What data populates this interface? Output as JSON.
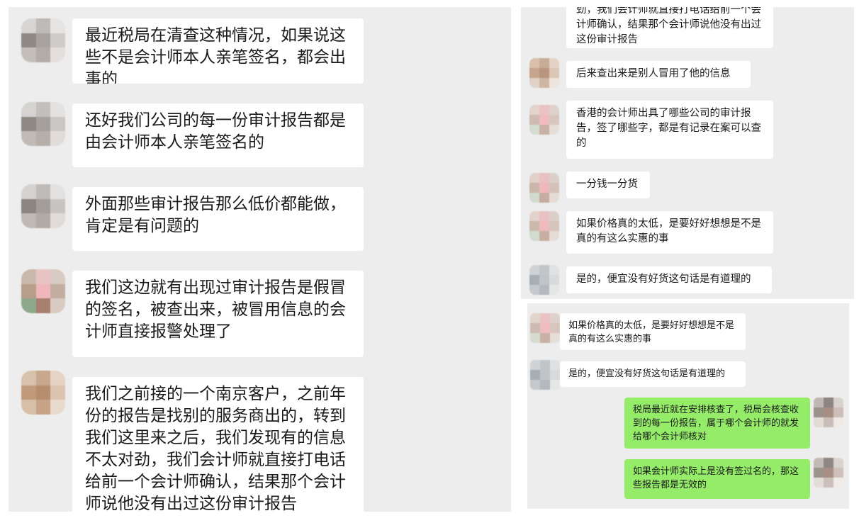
{
  "left_chat": {
    "messages": [
      {
        "text": "最近税局在清查这种情况，如果说这些不是会计师本人亲笔签名，都会出事的"
      },
      {
        "text": "还好我们公司的每一份审计报告都是由会计师本人亲笔签名的"
      },
      {
        "text": "外面那些审计报告那么低价都能做，肯定是有问题的"
      },
      {
        "text": "我们这边就有出现过审计报告是假冒的签名，被查出来，被冒用信息的会计师直接报警处理了"
      },
      {
        "text": "我们之前接的一个南京客户，之前年份的报告是找别的服务商出的，转到我们这里来之后，我们发现有的信息不太对劲，我们会计师就直接打电话给前一个会计师确认，结果那个会计师说他没有出过这份审计报告"
      }
    ]
  },
  "right_top_chat": {
    "messages": [
      {
        "text": "劲，我们会计师就直接打电话给前一个会计师确认，结果那个会计师说他没有出过这份审计报告"
      },
      {
        "text": "后来查出来是别人冒用了他的信息"
      },
      {
        "text": "香港的会计师出具了哪些公司的审计报告，签了哪些字，都是有记录在案可以查的"
      },
      {
        "text": "一分钱一分货"
      },
      {
        "text": "如果价格真的太低，是要好好想想是不是真的有这么实惠的事"
      },
      {
        "text": "是的，便宜没有好货这句话是有道理的"
      }
    ]
  },
  "right_bottom_chat": {
    "messages": [
      {
        "text": "如果价格真的太低，是要好好想想是不是真的有这么实惠的事",
        "sender": "other"
      },
      {
        "text": "是的，便宜没有好货这句话是有道理的",
        "sender": "other"
      },
      {
        "text": "税局最近就在安排核查了，税局会核查收到的每一份报告，属于哪个会计师的就发给哪个会计师核对",
        "sender": "me"
      },
      {
        "text": "如果会计师实际上是没有签过名的，那这些报告都是无效的",
        "sender": "me"
      }
    ]
  },
  "colors": {
    "panel_bg": "#ededed",
    "bubble_other": "#ffffff",
    "bubble_me": "#95ec69",
    "text": "#1a1a1a"
  }
}
